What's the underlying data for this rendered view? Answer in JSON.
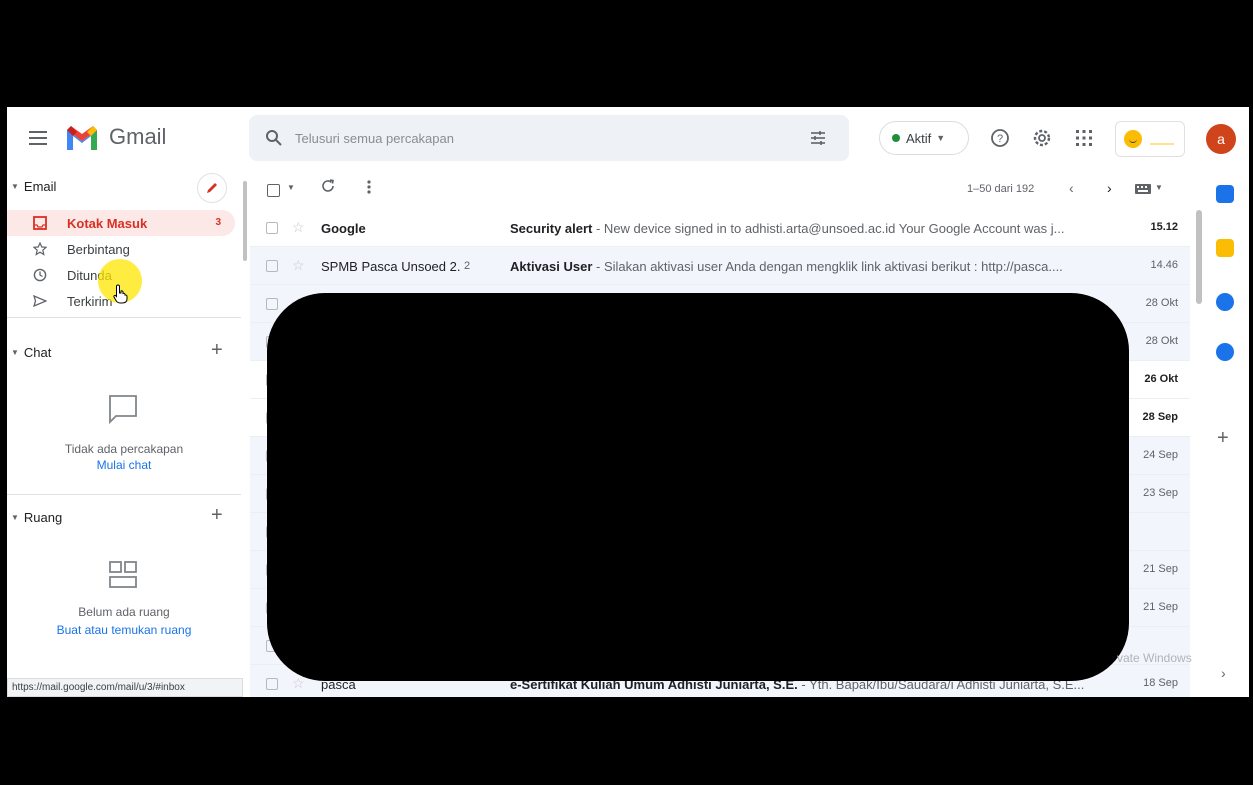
{
  "header": {
    "app_name": "Gmail",
    "search_placeholder": "Telusuri semua percakapan",
    "status_label": "Aktif",
    "avatar_initial": "a"
  },
  "sidebar": {
    "email_section": "Email",
    "items": [
      {
        "label": "Kotak Masuk",
        "count": "3",
        "icon": "inbox-icon",
        "active": true
      },
      {
        "label": "Berbintang",
        "count": "",
        "icon": "star-icon",
        "active": false
      },
      {
        "label": "Ditunda",
        "count": "",
        "icon": "clock-icon",
        "active": false
      },
      {
        "label": "Terkirim",
        "count": "",
        "icon": "send-icon",
        "active": false
      }
    ],
    "chat_section": "Chat",
    "chat_empty": "Tidak ada percakapan",
    "chat_link": "Mulai chat",
    "rooms_section": "Ruang",
    "rooms_empty": "Belum ada ruang",
    "rooms_link": "Buat atau temukan ruang"
  },
  "status_url": "https://mail.google.com/mail/u/3/#inbox",
  "toolbar": {
    "pagination": "1–50 dari 192"
  },
  "mails": [
    {
      "sender": "Google",
      "count": "",
      "subject": "Security alert",
      "snippet": " - New device signed in to adhisti.arta@unsoed.ac.id Your Google Account was j...",
      "date": "15.12",
      "unread": true
    },
    {
      "sender": "SPMB Pasca Unsoed 2.",
      "count": "2",
      "subject": "Aktivasi User",
      "snippet": " - Silakan aktivasi user Anda dengan mengklik link aktivasi berikut : http://pasca....",
      "date": "14.46",
      "unread": false
    },
    {
      "sender": "",
      "count": "",
      "subject": "",
      "snippet": "",
      "date": "28 Okt",
      "unread": false
    },
    {
      "sender": "",
      "count": "",
      "subject": "",
      "snippet": "",
      "date": "28 Okt",
      "unread": false
    },
    {
      "sender": "",
      "count": "",
      "subject": "",
      "snippet": "",
      "date": "26 Okt",
      "unread": true
    },
    {
      "sender": "",
      "count": "",
      "subject": "",
      "snippet": "",
      "date": "28 Sep",
      "unread": true
    },
    {
      "sender": "",
      "count": "",
      "subject": "",
      "snippet": "",
      "date": "24 Sep",
      "unread": false
    },
    {
      "sender": "",
      "count": "",
      "subject": "",
      "snippet": "",
      "date": "23 Sep",
      "unread": false
    },
    {
      "sender": "",
      "count": "",
      "subject": "",
      "snippet": "",
      "date": "",
      "unread": false
    },
    {
      "sender": "",
      "count": "",
      "subject": "",
      "snippet": "",
      "date": "21 Sep",
      "unread": false
    },
    {
      "sender": "",
      "count": "",
      "subject": "",
      "snippet": "",
      "date": "21 Sep",
      "unread": false
    },
    {
      "sender": "",
      "count": "",
      "subject": "",
      "snippet": "",
      "date": "",
      "unread": false
    },
    {
      "sender": "pasca",
      "count": "",
      "subject": "e-Sertifikat Kuliah Umum Adhisti Juniarta, S.E.",
      "snippet": " - Yth. Bapak/Ibu/Saudara/i Adhisti Juniarta, S.E...",
      "date": "18 Sep",
      "unread": false
    }
  ],
  "watermark": "vate Windows",
  "colors": {
    "accent_red": "#d93025",
    "active_bg": "#fce8e6",
    "link_blue": "#1a73e8",
    "avatar": "#d0441c"
  }
}
